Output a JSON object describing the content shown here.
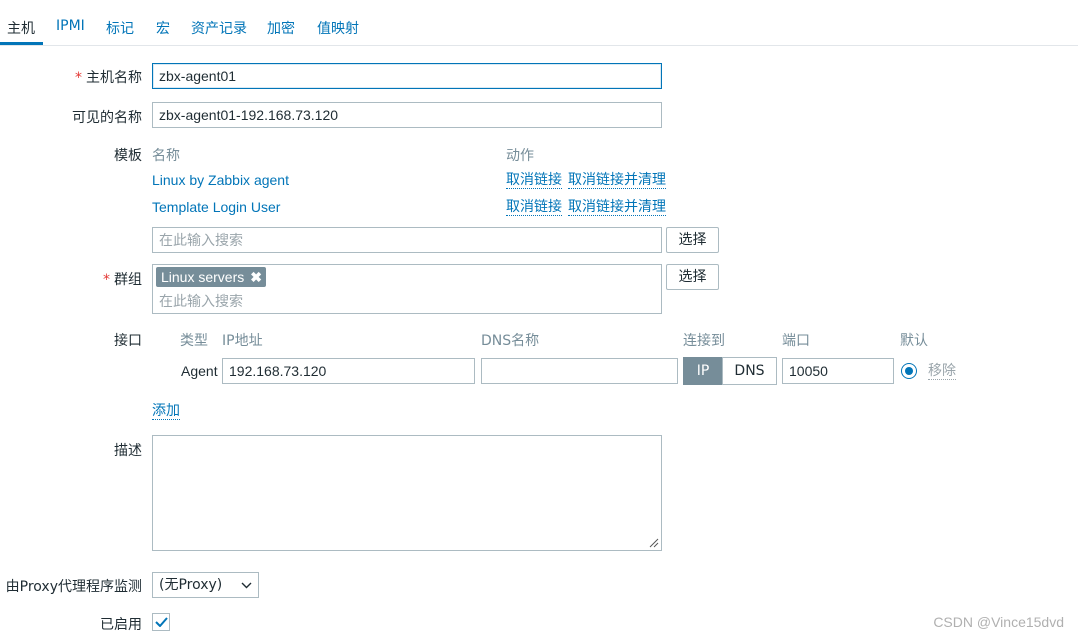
{
  "tabs": [
    {
      "label": "主机",
      "active": true
    },
    {
      "label": "IPMI"
    },
    {
      "label": "标记"
    },
    {
      "label": "宏"
    },
    {
      "label": "资产记录"
    },
    {
      "label": "加密"
    },
    {
      "label": "值映射"
    }
  ],
  "host_name": {
    "label": "主机名称",
    "required_mark": "*",
    "value": "zbx-agent01"
  },
  "visible_name": {
    "label": "可见的名称",
    "value": "zbx-agent01-192.168.73.120"
  },
  "templates": {
    "label": "模板",
    "col_name": "名称",
    "col_action": "动作",
    "rows": [
      {
        "name": "Linux by Zabbix agent",
        "unlink": "取消链接",
        "unlink_clear": "取消链接并清理"
      },
      {
        "name": "Template Login User",
        "unlink": "取消链接",
        "unlink_clear": "取消链接并清理"
      }
    ],
    "search_placeholder": "在此输入搜索",
    "select_button": "选择"
  },
  "groups": {
    "label": "群组",
    "required_mark": "*",
    "chip": "Linux servers",
    "chip_remove_icon": "✖",
    "search_placeholder": "在此输入搜索",
    "select_button": "选择"
  },
  "interfaces": {
    "label": "接口",
    "headers": {
      "type": "类型",
      "ip": "IP地址",
      "dns": "DNS名称",
      "connect": "连接到",
      "port": "端口",
      "default": "默认"
    },
    "row": {
      "type": "Agent",
      "ip": "192.168.73.120",
      "dns": "",
      "connect_ip": "IP",
      "connect_dns": "DNS",
      "connect_selected": "IP",
      "port": "10050",
      "remove": "移除"
    },
    "add_link": "添加"
  },
  "description": {
    "label": "描述",
    "value": ""
  },
  "proxy": {
    "label": "由Proxy代理程序监测",
    "value": "(无Proxy)"
  },
  "enabled": {
    "label": "已启用",
    "checked": true
  },
  "watermark": "CSDN @Vince15dvd",
  "colors": {
    "link": "#0275b8",
    "required": "#e33734",
    "chip_bg": "#768d99",
    "text": "#1f2c33",
    "muted": "#768d99"
  }
}
